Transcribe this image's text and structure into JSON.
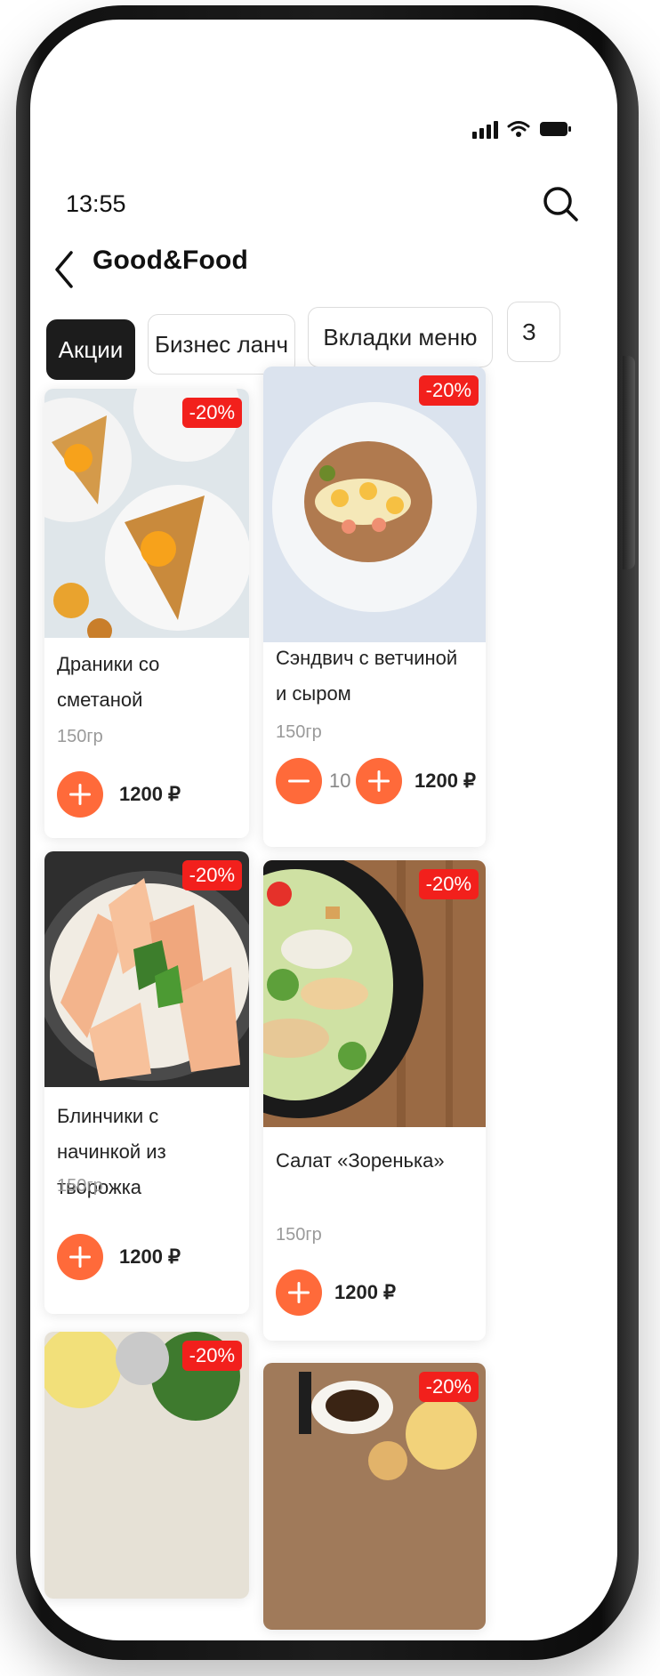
{
  "status_bar": {
    "time": "13:55"
  },
  "header": {
    "title": "Good&Food"
  },
  "tabs": [
    {
      "label": "Акции",
      "active": true
    },
    {
      "label": "Бизнес ланч",
      "active": false
    },
    {
      "label": "Вкладки меню",
      "active": false
    },
    {
      "label": "З",
      "active": false
    }
  ],
  "products": [
    {
      "name": "Драники со сметаной",
      "weight": "150гр",
      "price": "1200 ₽",
      "discount": "-20%",
      "quantity": null
    },
    {
      "name": "Сэндвич с ветчиной и сыром",
      "weight": "150гр",
      "price": "1200 ₽",
      "discount": "-20%",
      "quantity": "10"
    },
    {
      "name": "Блинчики с начинкой из творожка",
      "weight": "150гр",
      "price": "1200 ₽",
      "discount": "-20%",
      "quantity": null
    },
    {
      "name": "Салат «Зоренька»",
      "weight": "150гр",
      "price": "1200 ₽",
      "discount": "-20%",
      "quantity": null
    },
    {
      "name": "",
      "weight": "",
      "price": "",
      "discount": "-20%",
      "quantity": null
    },
    {
      "name": "",
      "weight": "",
      "price": "",
      "discount": "-20%",
      "quantity": null
    }
  ],
  "colors": {
    "accent": "#ff6a3a",
    "discount_badge": "#f2201c",
    "active_tab": "#1c1c1c"
  }
}
